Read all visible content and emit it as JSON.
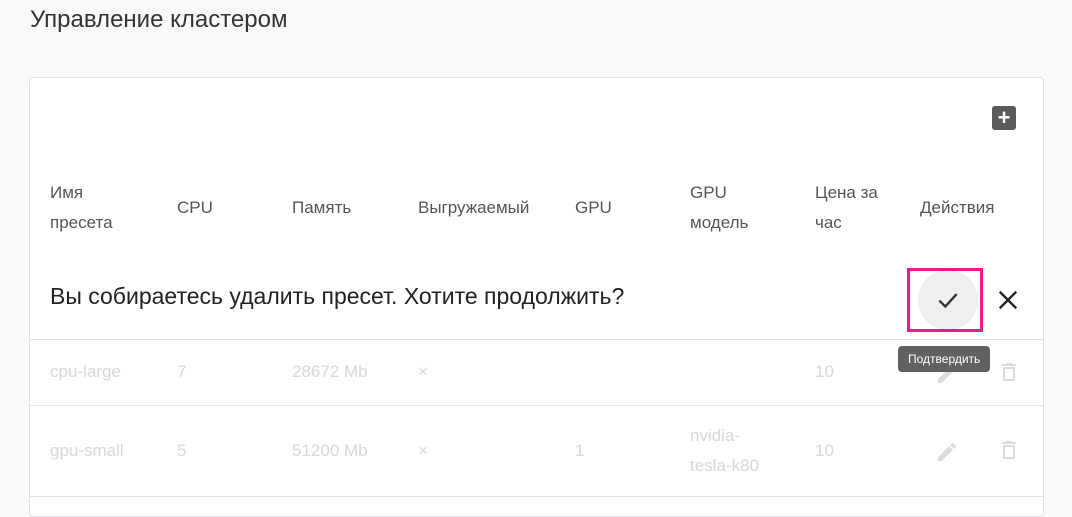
{
  "page": {
    "title": "Управление кластером"
  },
  "toolbar": {
    "add_label": "+"
  },
  "table": {
    "headers": {
      "name": "Имя\nпресета",
      "cpu": "CPU",
      "memory": "Память",
      "preemptible": "Выгружаемый",
      "gpu": "GPU",
      "gpu_model": "GPU\nмодель",
      "price": "Цена за\nчас",
      "actions": "Действия"
    },
    "rows": [
      {
        "name": "cpu-large",
        "cpu": "7",
        "memory": "28672 Mb",
        "preemptible": "×",
        "gpu": "",
        "gpu_model": "",
        "price": "10"
      },
      {
        "name": "gpu-small",
        "cpu": "5",
        "memory": "51200 Mb",
        "preemptible": "×",
        "gpu": "1",
        "gpu_model": "nvidia-\ntesla-k80",
        "price": "10"
      }
    ]
  },
  "confirm": {
    "message": "Вы собираетесь удалить пресет. Хотите продолжить?",
    "tooltip": "Подтвердить"
  },
  "colors": {
    "highlight": "#ee1b8c",
    "tooltip_bg": "#616161"
  },
  "icons": {
    "add": "plus-box-icon",
    "confirm": "check-icon",
    "cancel": "close-icon",
    "edit": "pencil-icon",
    "delete": "trash-icon"
  }
}
